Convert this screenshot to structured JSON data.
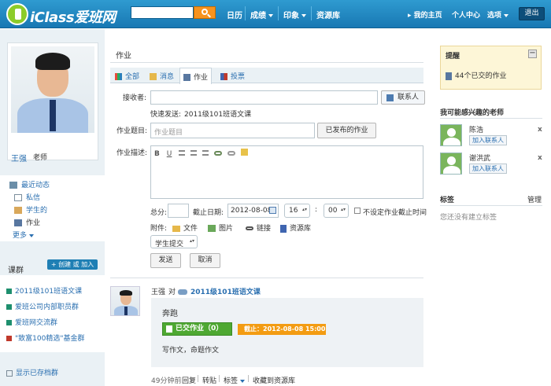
{
  "header": {
    "logo_text": "iClass爱班网",
    "nav": [
      {
        "label": "日历",
        "dropdown": false
      },
      {
        "label": "成绩",
        "dropdown": true
      },
      {
        "label": "印象",
        "dropdown": true
      },
      {
        "label": "资源库",
        "dropdown": false
      }
    ],
    "right_nav": [
      {
        "label": "我的主页"
      },
      {
        "label": "个人中心"
      },
      {
        "label": "选项"
      }
    ],
    "logout_label": "退出",
    "accent_color": "#1f86c0"
  },
  "profile": {
    "name": "王强",
    "role": "老师"
  },
  "left_nav": {
    "items": [
      {
        "label": "最近动态",
        "icon": "activity-icon"
      },
      {
        "label": "私信",
        "icon": "mail-icon"
      },
      {
        "label": "学生的",
        "icon": "student-icon"
      },
      {
        "label": "作业",
        "icon": "homework-icon"
      }
    ],
    "more_label": "更多"
  },
  "groups": {
    "title": "课群",
    "create_label": "+ 创建 或 加入",
    "items": [
      {
        "label": "2011级101班语文课"
      },
      {
        "label": "爱班公司内部职员群"
      },
      {
        "label": "爱班网交流群"
      },
      {
        "label": "\"致富100精选\"基金群"
      }
    ],
    "show_archived_label": "显示已存档群"
  },
  "main": {
    "page_title": "作业",
    "tabs": [
      {
        "label": "全部",
        "icon": "grid-icon"
      },
      {
        "label": "消息",
        "icon": "message-icon"
      },
      {
        "label": "作业",
        "icon": "homework-icon"
      },
      {
        "label": "投票",
        "icon": "chart-icon"
      }
    ],
    "form": {
      "recipient_label": "接收者:",
      "recipient_value": "",
      "contact_button": "联系人",
      "quick_send_label": "快速发送:",
      "quick_send_link": "2011级101班语文课",
      "title_label": "作业题目:",
      "title_placeholder": "作业题目",
      "published_button": "已发布的作业",
      "desc_label": "作业描述:",
      "toolbar": [
        "B",
        "U"
      ],
      "score_label": "总分:",
      "score_value": "",
      "deadline_label": "截止日期:",
      "deadline_date": "2012-08-08",
      "deadline_hour": "16",
      "time_colon": ":",
      "deadline_minute": "00",
      "no_deadline_label": "不设定作业截止时间",
      "attach_label": "附件:",
      "attachments": [
        {
          "label": "文件",
          "icon": "folder-icon"
        },
        {
          "label": "图片",
          "icon": "image-icon"
        },
        {
          "label": "链接",
          "icon": "link-icon"
        },
        {
          "label": "资源库",
          "icon": "book-icon"
        }
      ],
      "submit_mode": "学生提交",
      "send_button": "发送",
      "cancel_button": "取消"
    },
    "post": {
      "author": "王强",
      "to_label": "对",
      "group": "2011级101班语文课",
      "title": "奔跑",
      "submitted_label": "已交作业（0）",
      "deadline_label": "截止：2012-08-08 15:00",
      "body": "写作文，命题作文",
      "time": "49分钟前",
      "actions": [
        "回复",
        "转贴",
        "标签",
        "收藏到资源库"
      ]
    }
  },
  "right": {
    "reminder_title": "提醒",
    "reminder_item": "44个已交的作业",
    "teachers_title": "我可能感兴趣的老师",
    "teachers": [
      {
        "name": "陈浩",
        "add_label": "加入联系人"
      },
      {
        "name": "谢洪武",
        "add_label": "加入联系人"
      }
    ],
    "close_glyph": "x",
    "tags_title": "标签",
    "tags_manage": "管理",
    "tags_empty": "您还没有建立标签"
  }
}
